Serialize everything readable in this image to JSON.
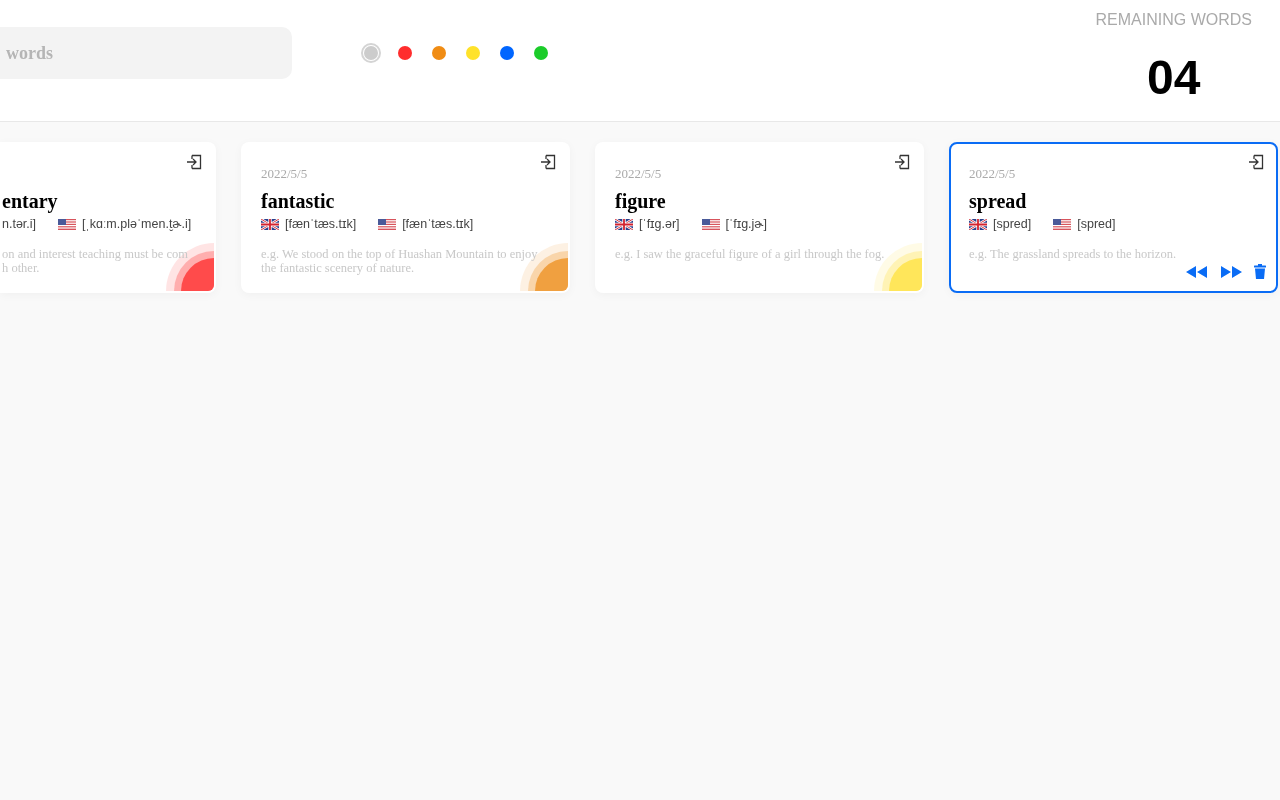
{
  "search": {
    "placeholder": "words"
  },
  "color_filters": [
    {
      "color": "#cccccc",
      "selected": true
    },
    {
      "color": "#ff2d2d",
      "selected": false
    },
    {
      "color": "#f08c14",
      "selected": false
    },
    {
      "color": "#ffe22a",
      "selected": false
    },
    {
      "color": "#0066ff",
      "selected": false
    },
    {
      "color": "#1bcc2a",
      "selected": false
    }
  ],
  "remaining": {
    "label": "REMAINING WORDS",
    "count": "04"
  },
  "cards": [
    {
      "word": "entary",
      "pronunciations": [
        {
          "kind": "plain",
          "text": "n.tər.i]"
        },
        {
          "kind": "us",
          "text": "[ˌkɑːm.pləˈmen.t̬ɚ.i]"
        }
      ],
      "example": "on and interest teaching must be com\nh other.",
      "color": "#ff4b4b",
      "selected": false
    },
    {
      "date": "2022/5/5",
      "word": "fantastic",
      "pronunciations": [
        {
          "kind": "uk",
          "text": "[fænˈtæs.tɪk]"
        },
        {
          "kind": "us",
          "text": "[fænˈtæs.tɪk]"
        }
      ],
      "example": "e.g. We stood on the top of Huashan Mountain to enjoy the fantastic scenery of nature.",
      "color": "#f0a040",
      "selected": false
    },
    {
      "date": "2022/5/5",
      "word": "figure",
      "pronunciations": [
        {
          "kind": "uk",
          "text": "[ˈfɪɡ.ər]"
        },
        {
          "kind": "us",
          "text": "[ˈfɪɡ.jɚ]"
        }
      ],
      "example": "e.g. I saw the graceful figure of a girl through the fog.",
      "color": "#ffe65a",
      "selected": false
    },
    {
      "date": "2022/5/5",
      "word": "spread",
      "pronunciations": [
        {
          "kind": "uk",
          "text": "[spred]"
        },
        {
          "kind": "us",
          "text": "[spred]"
        }
      ],
      "example": "e.g. The grassland spreads to the horizon.",
      "selected": true
    }
  ]
}
